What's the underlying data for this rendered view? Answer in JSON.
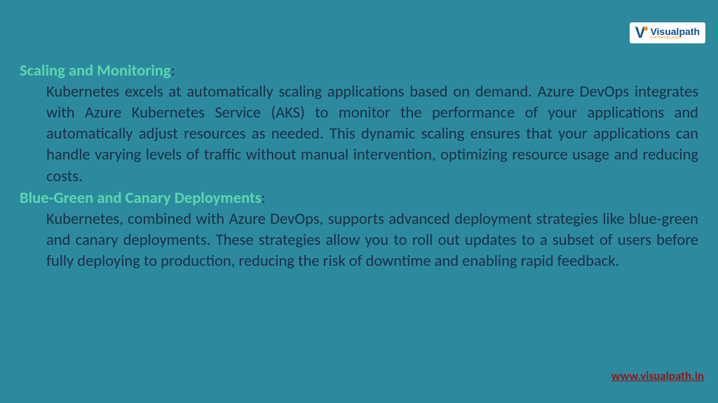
{
  "logo": {
    "name": "Visualpath",
    "tagline": "e-technology school"
  },
  "sections": [
    {
      "heading": "Scaling and Monitoring",
      "body": "Kubernetes excels at automatically scaling applications based on demand. Azure DevOps integrates with Azure Kubernetes Service (AKS) to monitor the performance of your applications and automatically adjust resources as needed. This dynamic scaling ensures that your applications can handle varying levels of traffic without manual intervention, optimizing resource usage and reducing costs."
    },
    {
      "heading": "Blue-Green and Canary Deployments",
      "body": "Kubernetes, combined with Azure DevOps, supports advanced deployment strategies like blue-green and canary deployments. These strategies allow you to roll out updates to a subset of users before fully deploying to production, reducing the risk of downtime and enabling rapid feedback."
    }
  ],
  "footer": {
    "url": "www.visualpath.in"
  }
}
